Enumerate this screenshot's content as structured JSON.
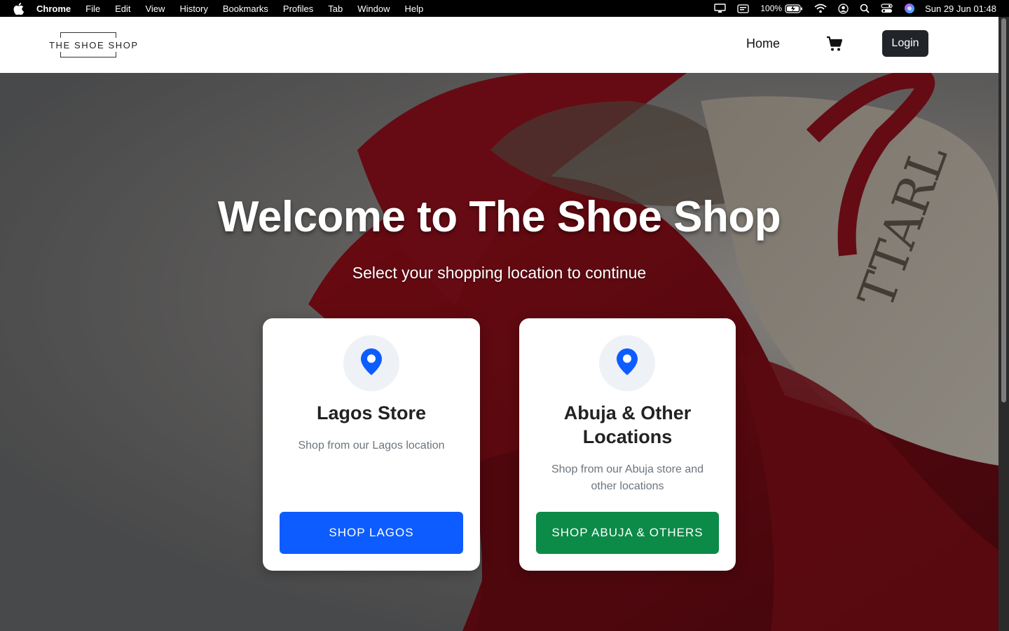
{
  "menubar": {
    "app_name": "Chrome",
    "items": [
      "File",
      "Edit",
      "View",
      "History",
      "Bookmarks",
      "Profiles",
      "Tab",
      "Window",
      "Help"
    ],
    "battery_text": "100%",
    "clock": "Sun 29 Jun  01:48",
    "icons": [
      "apple-icon",
      "display-icon",
      "keyboard-icon",
      "battery-icon",
      "wifi-icon",
      "user-icon",
      "search-icon",
      "control-center-icon",
      "siri-icon"
    ]
  },
  "navbar": {
    "logo_text": "THE SHOE SHOP",
    "home_label": "Home",
    "login_label": "Login",
    "cart_icon": "cart-icon"
  },
  "hero": {
    "title": "Welcome to The Shoe Shop",
    "subtitle": "Select your shopping location to continue"
  },
  "locations": [
    {
      "title": "Lagos Store",
      "description": "Shop from our Lagos location",
      "button_label": "SHOP LAGOS",
      "button_color": "#0d5cff",
      "icon": "map-pin-icon"
    },
    {
      "title": "Abuja & Other Locations",
      "description": "Shop from our Abuja store and other locations",
      "button_label": "SHOP ABUJA & OTHERS",
      "button_color": "#0c8a48",
      "icon": "map-pin-icon"
    }
  ],
  "colors": {
    "accent_blue": "#0d5cff",
    "accent_green": "#0c8a48",
    "login_bg": "#212529",
    "pin_blue": "#0d5cff"
  }
}
